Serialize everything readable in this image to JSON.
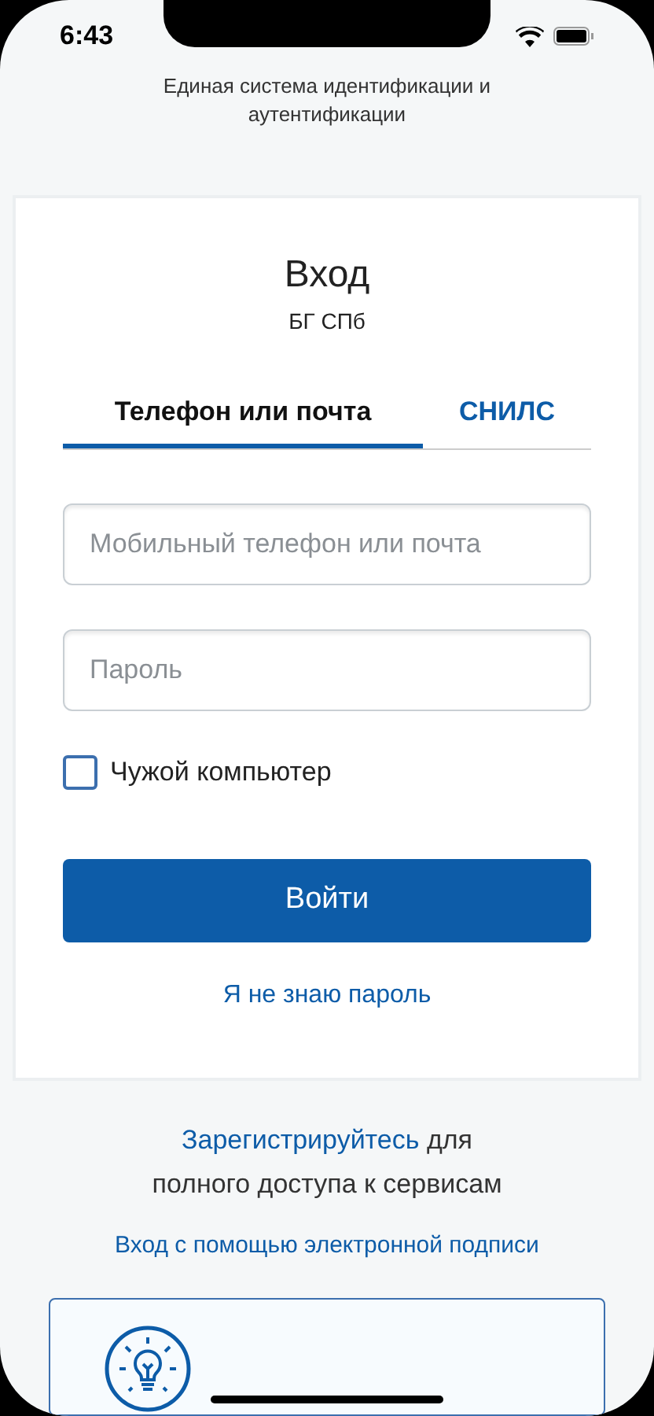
{
  "status_bar": {
    "time": "6:43"
  },
  "header": {
    "subtitle": "Единая система идентификации и аутентификации"
  },
  "login": {
    "title": "Вход",
    "subtitle": "БГ СПб",
    "tabs": [
      {
        "label": "Телефон или почта",
        "selected": true
      },
      {
        "label": "СНИЛС",
        "selected": false
      }
    ],
    "login_field": {
      "placeholder": "Мобильный телефон или почта"
    },
    "password_field": {
      "placeholder": "Пароль"
    },
    "remember": {
      "label": "Чужой компьютер",
      "checked": false
    },
    "submit": "Войти",
    "forgot": "Я не знаю пароль"
  },
  "register": {
    "link": "Зарегистрируйтесь",
    "text": "для полного доступа к сервисам"
  },
  "signature_link": "Вход с помощью электронной подписи"
}
